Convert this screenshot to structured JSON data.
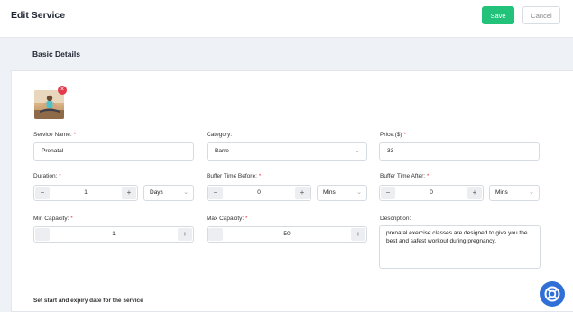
{
  "header": {
    "title": "Edit Service",
    "save_label": "Save",
    "cancel_label": "Cancel"
  },
  "section": {
    "title": "Basic Details"
  },
  "form": {
    "service_name": {
      "label": "Service Name:",
      "required": "*",
      "value": "Prenatal"
    },
    "category": {
      "label": "Category:",
      "value": "Barre"
    },
    "price": {
      "label": "Price:($)",
      "required": "*",
      "value": "33"
    },
    "duration": {
      "label": "Duration:",
      "required": "*",
      "value": "1",
      "unit": "Days"
    },
    "buffer_before": {
      "label": "Buffer Time Before:",
      "required": "*",
      "value": "0",
      "unit": "Mins"
    },
    "buffer_after": {
      "label": "Buffer Time After:",
      "required": "*",
      "value": "0",
      "unit": "Mins"
    },
    "min_capacity": {
      "label": "Min Capacity:",
      "required": "*",
      "value": "1"
    },
    "max_capacity": {
      "label": "Max Capacity:",
      "required": "*",
      "value": "50"
    },
    "description": {
      "label": "Description:",
      "value": "prenatal exercise classes are designed to give you the best and safest workout during pregnancy."
    }
  },
  "stepper": {
    "minus": "−",
    "plus": "+"
  },
  "select_chevron": "⌄",
  "remove_symbol": "×",
  "expiry_text": "Set start and expiry date for the service"
}
